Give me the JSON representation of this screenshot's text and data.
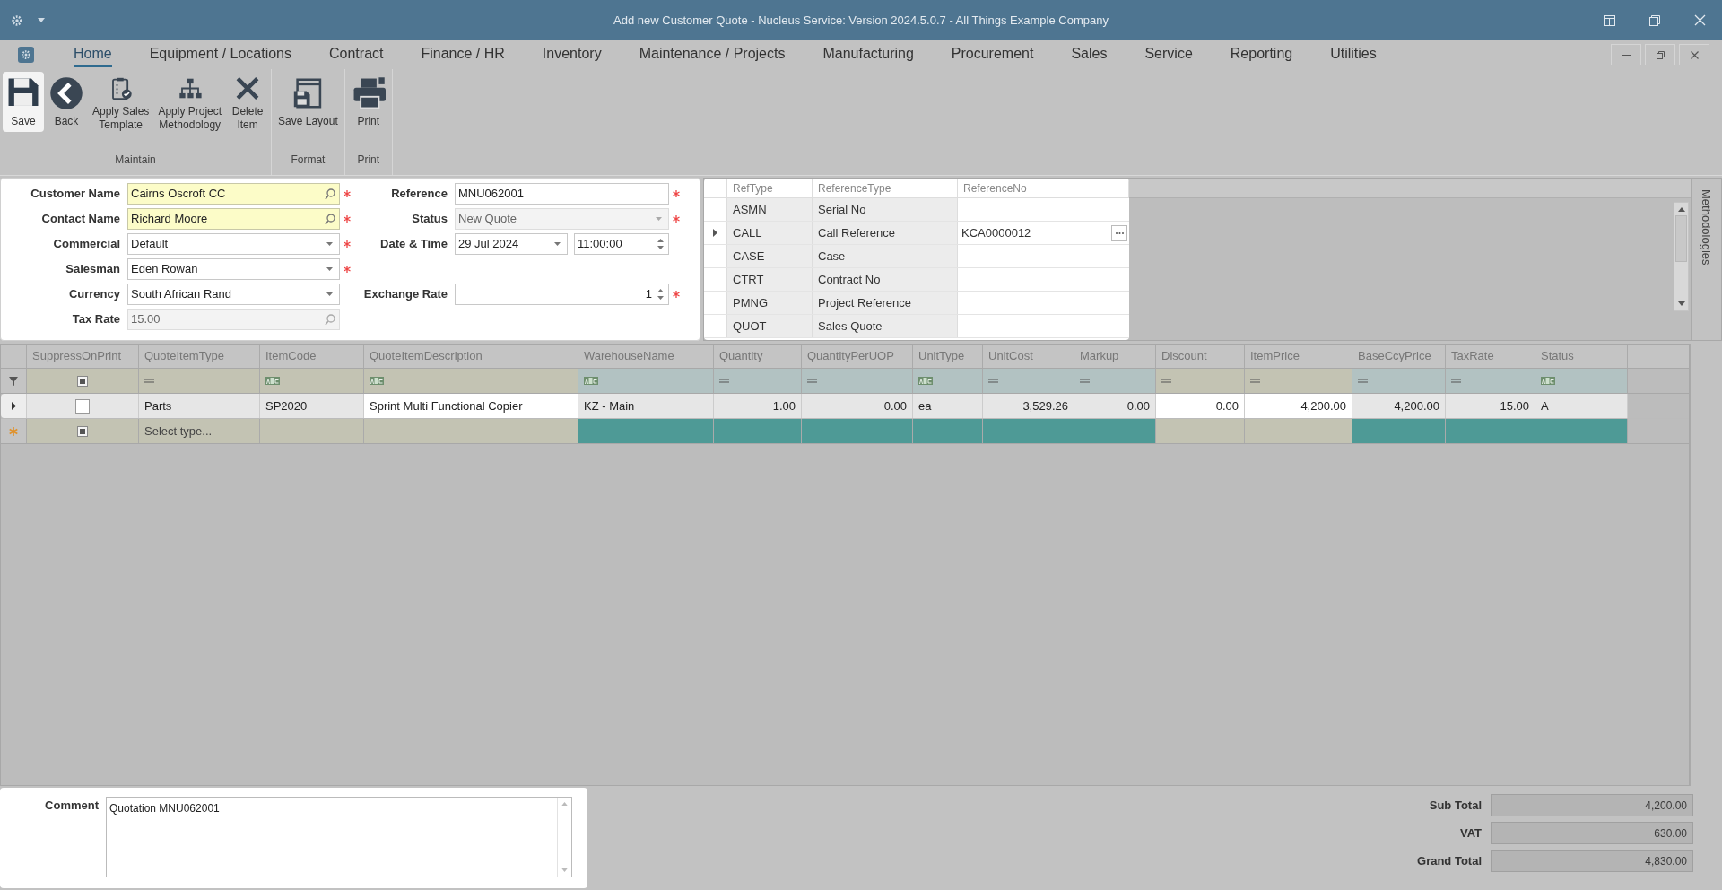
{
  "window": {
    "title": "Add new Customer Quote - Nucleus Service: Version 2024.5.0.7 - All Things Example Company"
  },
  "menu_tabs": [
    {
      "label": "Home",
      "selected": true
    },
    {
      "label": "Equipment / Locations",
      "selected": false
    },
    {
      "label": "Contract",
      "selected": false
    },
    {
      "label": "Finance / HR",
      "selected": false
    },
    {
      "label": "Inventory",
      "selected": false
    },
    {
      "label": "Maintenance / Projects",
      "selected": false
    },
    {
      "label": "Manufacturing",
      "selected": false
    },
    {
      "label": "Procurement",
      "selected": false
    },
    {
      "label": "Sales",
      "selected": false
    },
    {
      "label": "Service",
      "selected": false
    },
    {
      "label": "Reporting",
      "selected": false
    },
    {
      "label": "Utilities",
      "selected": false
    }
  ],
  "ribbon": [
    {
      "group": "Maintain",
      "buttons": [
        {
          "label": "Save",
          "selected": true
        },
        {
          "label": "Back",
          "selected": false
        },
        {
          "label": "Apply Sales\nTemplate",
          "selected": false
        },
        {
          "label": "Apply Project\nMethodology",
          "selected": false
        },
        {
          "label": "Delete\nItem",
          "selected": false
        }
      ]
    },
    {
      "group": "Format",
      "buttons": [
        {
          "label": "Save Layout",
          "selected": false
        }
      ]
    },
    {
      "group": "Print",
      "buttons": [
        {
          "label": "Print",
          "selected": false
        }
      ]
    }
  ],
  "form": {
    "left": [
      {
        "label": "Customer Name",
        "value": "Cairns Oscroft CC",
        "kind": "lookup",
        "required": true,
        "highlighted": true,
        "disabled": false
      },
      {
        "label": "Contact Name",
        "value": "Richard Moore",
        "kind": "lookup",
        "required": true,
        "highlighted": true,
        "disabled": false
      },
      {
        "label": "Commercial",
        "value": "Default",
        "kind": "dropdown",
        "required": true,
        "highlighted": false,
        "disabled": false
      },
      {
        "label": "Salesman",
        "value": "Eden Rowan",
        "kind": "dropdown",
        "required": true,
        "highlighted": false,
        "disabled": false
      },
      {
        "label": "Currency",
        "value": "South African Rand",
        "kind": "dropdown",
        "required": false,
        "highlighted": false,
        "disabled": false
      },
      {
        "label": "Tax Rate",
        "value": "15.00",
        "kind": "lookup",
        "required": false,
        "highlighted": false,
        "disabled": true
      }
    ],
    "right": [
      {
        "label": "Reference",
        "value": "MNU062001",
        "kind": "text",
        "required": true,
        "disabled": false
      },
      {
        "label": "Status",
        "value": "New Quote",
        "kind": "dropdown",
        "required": true,
        "disabled": true
      },
      {
        "label": "Date & Time",
        "value": "29 Jul 2024",
        "time": "11:00:00",
        "kind": "datetime",
        "required": false,
        "disabled": false
      },
      {
        "kind": "blank"
      },
      {
        "label": "Exchange Rate",
        "value": "1",
        "kind": "spin",
        "required": true,
        "disabled": false
      }
    ]
  },
  "references": {
    "columns": [
      "RefType",
      "ReferenceType",
      "ReferenceNo"
    ],
    "rows": [
      {
        "ref_type": "ASMN",
        "reference_type": "Serial No",
        "selected": false
      },
      {
        "ref_type": "CALL",
        "reference_type": "Call Reference",
        "reference_no": "KCA0000012",
        "selected": true
      },
      {
        "ref_type": "CASE",
        "reference_type": "Case",
        "selected": false
      },
      {
        "ref_type": "CTRT",
        "reference_type": "Contract No",
        "selected": false
      },
      {
        "ref_type": "PMNG",
        "reference_type": "Project Reference",
        "selected": false
      },
      {
        "ref_type": "QUOT",
        "reference_type": "Sales Quote",
        "selected": false
      }
    ]
  },
  "side_panel": {
    "label": "Methodologies"
  },
  "grid": {
    "columns": [
      {
        "header": "SuppressOnPrint",
        "locked": false,
        "numeric": false
      },
      {
        "header": "QuoteItemType",
        "locked": false,
        "numeric": false
      },
      {
        "header": "ItemCode",
        "locked": false,
        "numeric": false
      },
      {
        "header": "QuoteItemDescription",
        "locked": false,
        "numeric": false
      },
      {
        "header": "WarehouseName",
        "locked": true,
        "numeric": false
      },
      {
        "header": "Quantity",
        "locked": true,
        "numeric": true
      },
      {
        "header": "QuantityPerUOP",
        "locked": true,
        "numeric": true
      },
      {
        "header": "UnitType",
        "locked": true,
        "numeric": false
      },
      {
        "header": "UnitCost",
        "locked": true,
        "numeric": true
      },
      {
        "header": "Markup",
        "locked": true,
        "numeric": true
      },
      {
        "header": "Discount",
        "locked": false,
        "numeric": true
      },
      {
        "header": "ItemPrice",
        "locked": false,
        "numeric": true
      },
      {
        "header": "BaseCcyPrice",
        "locked": true,
        "numeric": true
      },
      {
        "header": "TaxRate",
        "locked": true,
        "numeric": true
      },
      {
        "header": "Status",
        "locked": true,
        "numeric": false
      }
    ],
    "rows": [
      {
        "current": true,
        "cells": [
          {
            "kind": "checkbox",
            "checked": false,
            "editable": false
          },
          {
            "text": "Parts",
            "editable": false
          },
          {
            "text": "SP2020",
            "editable": false
          },
          {
            "text": "Sprint Multi Functional Copier",
            "editable": true
          },
          {
            "text": "KZ - Main",
            "editable": false
          },
          {
            "text": "1.00",
            "editable": false
          },
          {
            "text": "0.00",
            "editable": false
          },
          {
            "text": "ea",
            "editable": false
          },
          {
            "text": "3,529.26",
            "editable": false
          },
          {
            "text": "0.00",
            "editable": false
          },
          {
            "text": "0.00",
            "editable": true
          },
          {
            "text": "4,200.00",
            "editable": true
          },
          {
            "text": "4,200.00",
            "editable": false
          },
          {
            "text": "15.00",
            "editable": false
          },
          {
            "text": "A",
            "editable": false
          }
        ]
      }
    ],
    "new_row": {
      "placeholder": "Select type..."
    }
  },
  "comment": {
    "label": "Comment",
    "value": "Quotation MNU062001"
  },
  "totals": [
    {
      "label": "Sub Total",
      "value": "4,200.00"
    },
    {
      "label": "VAT",
      "value": "630.00"
    },
    {
      "label": "Grand Total",
      "value": "4,830.00"
    }
  ]
}
